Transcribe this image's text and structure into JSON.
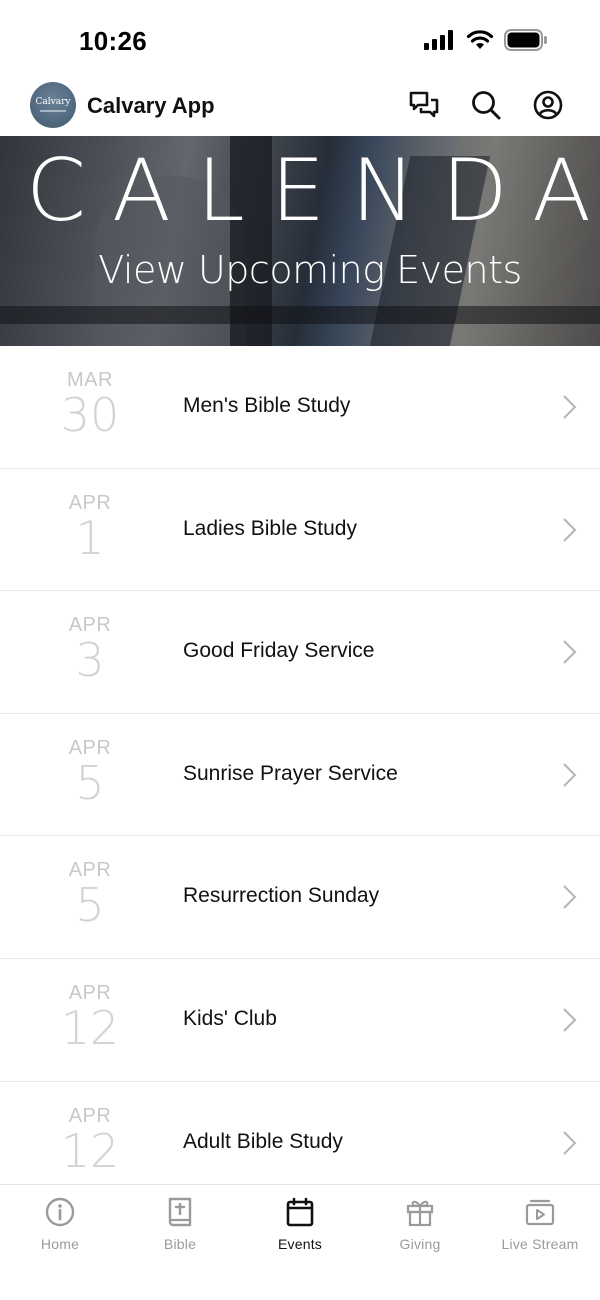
{
  "status_bar": {
    "time": "10:26"
  },
  "app": {
    "logo_text": "Calvary",
    "title": "Calvary App"
  },
  "header_icons": [
    "chat-icon",
    "search-icon",
    "account-icon"
  ],
  "hero": {
    "title": "CALENDAR",
    "subtitle": "View Upcoming Events"
  },
  "events": [
    {
      "month": "MAR",
      "day": "30",
      "title": "Men's Bible Study"
    },
    {
      "month": "APR",
      "day": "1",
      "title": "Ladies Bible Study"
    },
    {
      "month": "APR",
      "day": "3",
      "title": "Good Friday Service"
    },
    {
      "month": "APR",
      "day": "5",
      "title": "Sunrise Prayer Service"
    },
    {
      "month": "APR",
      "day": "5",
      "title": "Resurrection Sunday"
    },
    {
      "month": "APR",
      "day": "12",
      "title": "Kids' Club"
    },
    {
      "month": "APR",
      "day": "12",
      "title": "Adult Bible Study"
    }
  ],
  "tabs": [
    {
      "label": "Home",
      "icon": "info-icon"
    },
    {
      "label": "Bible",
      "icon": "bible-icon"
    },
    {
      "label": "Events",
      "icon": "calendar-icon",
      "active": true
    },
    {
      "label": "Giving",
      "icon": "gift-icon"
    },
    {
      "label": "Live Stream",
      "icon": "live-stream-icon"
    }
  ],
  "colors": {
    "active_tab": "#111111",
    "inactive_tab": "#9a9a9a",
    "date_text": "#c8c8c8",
    "logo_bg": "#4e667c"
  }
}
